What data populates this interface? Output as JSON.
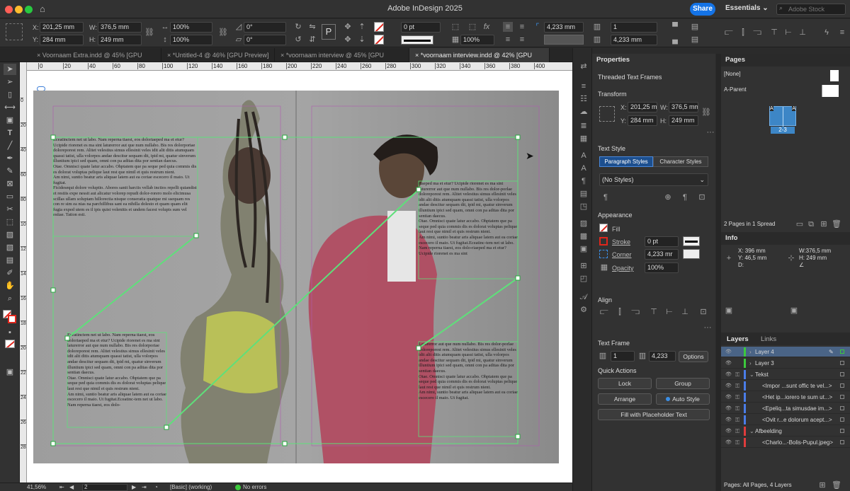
{
  "app": {
    "title": "Adobe InDesign 2025",
    "share_label": "Share",
    "workspace": "Essentials",
    "search_placeholder": "Adobe Stock"
  },
  "control": {
    "x": "201,25 mm",
    "y": "284 mm",
    "w": "376,5 mm",
    "h": "249 mm",
    "scale_x": "100%",
    "scale_y": "100%",
    "rotate": "0°",
    "shear": "0°",
    "stroke_weight": "0 pt",
    "opacity": "100%",
    "gutter_top": "4,233 mm",
    "gutter_bottom": "4,233 mm",
    "columns": "1"
  },
  "tabs": [
    {
      "label": "Voornaam Extra.indd @ 45% [GPU Preview]"
    },
    {
      "label": "*Untitled-4 @ 46% [GPU Preview]"
    },
    {
      "label": "*voornaam interview @ 45% [GPU Preview]"
    },
    {
      "label": "*voornaam interview.indd @ 42% [GPU Preview]"
    }
  ],
  "ruler_h": [
    "0",
    "20",
    "40",
    "60",
    "80",
    "100",
    "120",
    "140",
    "160",
    "180",
    "200",
    "220",
    "240",
    "260",
    "280",
    "300",
    "320",
    "340",
    "360",
    "380",
    "400"
  ],
  "ruler_v": [
    "0",
    "20",
    "40",
    "60",
    "80",
    "100",
    "120",
    "140",
    "160",
    "180",
    "200",
    "220",
    "240",
    "260",
    "280"
  ],
  "frames": {
    "f1": "Eceatinctem net ut labo. Nam reperna tiaest, eos doloriaeped ma et etur? Ucipide riorenet es ma sint laturerror aut que num nullabo. Bis res dolorporiae doloreporest rem. Alitet velestius simus ellesinit veles idit alit ditis atumquam quassi tatist, ulla volorpos andae descitur sequam dit, ipid mi, quatur sinverum illuntium ipici sed quam, omni con pa aditas dita por sentian daecus.\nOtae. Omnisci quate latur accabo. Ohptatem que pa seque ped quia commis dis es dolorat voluptas pelique laut rest que nimil et quis restrum nient.\nAm nimi, suntio beatur aris aliquae latem aut ea coriae escecero il maio. Ut fugitat.\nFicidesequi dolore voluptio. Abores sanit harciis vellab inctios repelli quiandist et restiis expe nessit aut alicatur volorep repudi dolor-rorero molo elicimusa scillas ullam soluptam hillorectia nisque conseratia quatque mi ssequam res con re sim ea nias na parchillibus sant ea nihilla dolesto et quam quam elit fugia exped utem es il ipis quist volenitis et undem facest volupis sum vel estiae. Tation esti.",
    "f2": "Eceatinctem net ut labo. Nam reperna tiaest, eos doloriaeped ma et etur? Ucipide riorenet es ma sint laturerror aut que num nullabo. Bis res dolorporiae doloreporest rem. Alitet velestius simus ellesinit veles idit alit ditis atumquam quassi tatist, ulla volorpos andae descitur sequam dit, ipid mi, quatur sinverum illuntium ipici sed quam, omni con pa aditas dita por sentian daecus.\nOtae. Omnisci quate latur accabo. Ohptatem que pa seque ped quia commis dis es dolorat voluptas pelique laut rest que nimil et quis restrum nient.\nAm nimi, suntio beatur aris aliquae latem aut ea coriae escecero il maio. Ut fugitat.Eceatinc-tem net ut labo. Nam reperna tiaest, eos dolo-",
    "f3": "riaeped ma et etur? Ucipide riorenet es ma sint laturerror aut que num nullabo. Bis res dolor-porlae doloreporest rem. Alitet velestius simus ellesinit veles idit alit ditis atumquam quassi tatist, ulla volorpos andae descitur sequam dit, ipid mi, quatur sinverum illuntium ipici sed quam, omni con pa aditas dita por sentian daecus.\nOtae. Omnisci quate latur accabo. Ohptatem que pa seque ped quia commis dis es dolorat voluptas pelique laut rest que nimil et quis restrum nient.\nAm nimi, suntio beatur aris aliquae latem aut ea coriae escecero il maio. Ut fugitat.Eceatinc-tem net ut labo. Nam reperna tiaest, eos dolo-riaeped ma et etur? Ucipide riorenet es ma sint",
    "f4": "Laturerror aut que num nullabo. Bis res dolor-porlae doloreporest rem. Alitet velestius simus ellesinit veles idit alit ditis atumquam quassi tatist, ulla volorpos andae descitur sequam dit, ipid mi, quatur sinverum illuntium ipici sed quam, omni con pa aditas dita por sentian daecus.\nOtae. Omnisci quate latur accabo. Ohptatem que pa seque ped quia commis dis es dolorat voluptas pelique laut rest que nimil et quis restrum nient.\nAm nimi, suntio beatur aris aliquae latem aut ea coriae escecero il maio. Ut fugitat."
  },
  "status": {
    "zoom": "41,56%",
    "page": "2",
    "style": "[Basic] (working)",
    "errors": "No errors"
  },
  "properties": {
    "title": "Properties",
    "selection": "Threaded Text Frames",
    "transform": "Transform",
    "x": "201,25 mm",
    "y": "284 mm",
    "w": "376,5 mm",
    "h": "249 mm",
    "text_style": "Text Style",
    "tab_para": "Paragraph Styles",
    "tab_char": "Character Styles",
    "style_value": "(No Styles)",
    "appearance": "Appearance",
    "fill": "Fill",
    "stroke": "Stroke",
    "stroke_value": "0 pt",
    "corner": "Corner",
    "corner_value": "4,233 mr",
    "opacity": "Opacity",
    "opacity_value": "100%",
    "align": "Align",
    "text_frame": "Text Frame",
    "columns": "1",
    "gutter": "4,233",
    "options": "Options",
    "quick_actions": "Quick Actions",
    "lock": "Lock",
    "group": "Group",
    "arrange": "Arrange",
    "auto_style": "Auto Style",
    "fill_placeholder": "Fill with Placeholder Text"
  },
  "pages": {
    "title": "Pages",
    "none": "[None]",
    "a_parent": "A-Parent",
    "spread_label": "2-3",
    "footer": "2 Pages in 1 Spread"
  },
  "info": {
    "title": "Info",
    "x": "X: 396 mm",
    "y": "Y: 46,5 mm",
    "d": "D:",
    "w": "W:376,5 mm",
    "h": "H: 249 mm"
  },
  "layers": {
    "tab_layers": "Layers",
    "tab_links": "Links",
    "items": [
      {
        "name": "Layer 4",
        "color": "#3cc93c"
      },
      {
        "name": "Layer 3",
        "color": "#3cc93c"
      },
      {
        "name": "Tekst",
        "color": "#4a7de8"
      },
      {
        "name": "<Impor ...sunt offic te vel...>",
        "color": "#4a7de8"
      },
      {
        "name": "<Het ip...iorero te sum ut...>",
        "color": "#4a7de8"
      },
      {
        "name": "<Epeliq...ta simusdae im...>",
        "color": "#4a7de8"
      },
      {
        "name": "<Ovit r...e dolorum acept...>",
        "color": "#4a7de8"
      },
      {
        "name": "Afbeelding",
        "color": "#e03c3c"
      },
      {
        "name": "<Charlo...-Bolis-Pupul.jpeg>",
        "color": "#e03c3c"
      }
    ],
    "footer": "Pages: All Pages, 4 Layers"
  }
}
